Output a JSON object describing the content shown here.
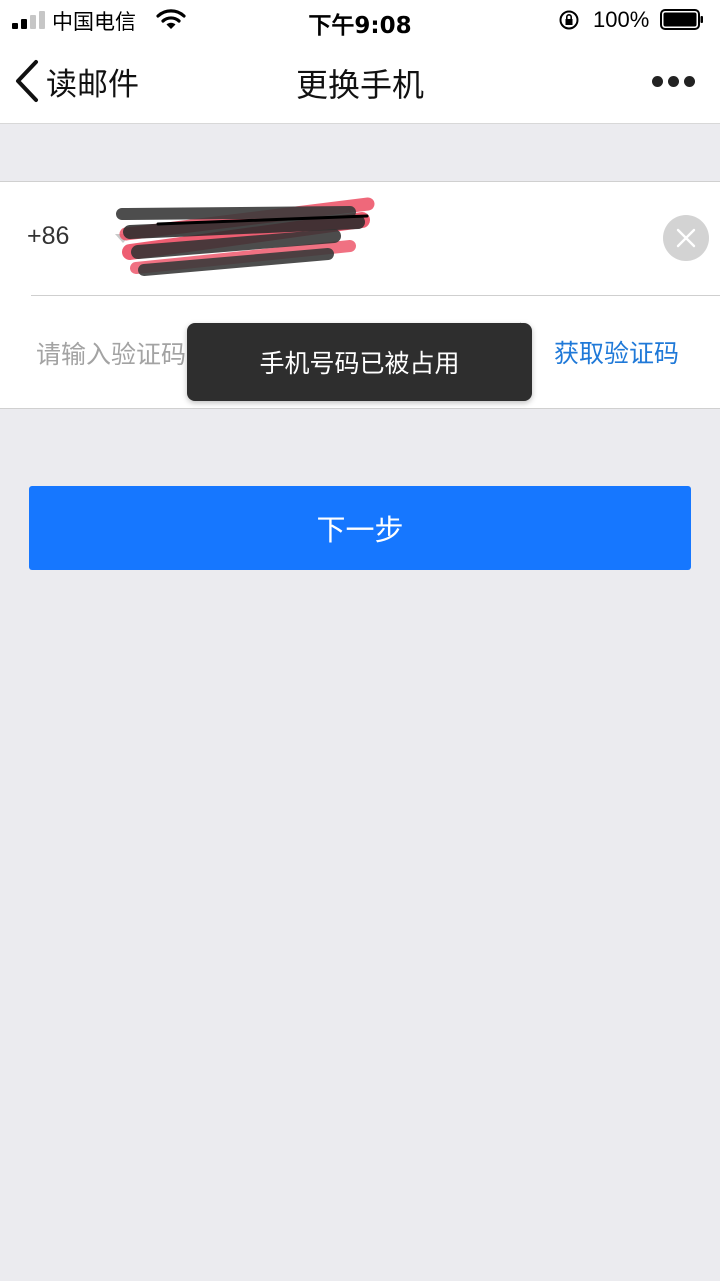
{
  "status_bar": {
    "carrier": "中国电信",
    "time": "下午9:08",
    "battery": "100%"
  },
  "nav": {
    "back_label": "读邮件",
    "title": "更换手机"
  },
  "form": {
    "country_code": "+86",
    "phone_value": "",
    "code_placeholder": "请输入验证码",
    "get_code_label": "获取验证码"
  },
  "next_button": "下一步",
  "toast": "手机号码已被占用",
  "colors": {
    "accent": "#1677ff",
    "link": "#1f79d8",
    "background": "#ebebef",
    "toast_bg": "#2e2e2e"
  }
}
